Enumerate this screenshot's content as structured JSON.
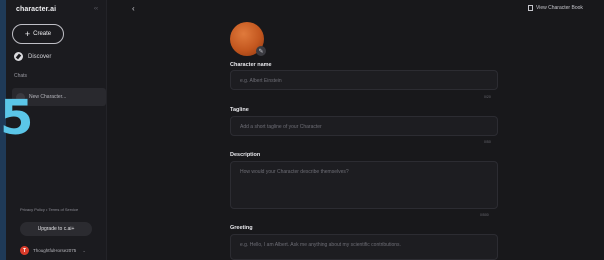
{
  "sidebar": {
    "brand": "character.ai",
    "create_label": "Create",
    "discover_label": "Discover",
    "chats_heading": "Chats",
    "chat_items": [
      {
        "label": "New Character..."
      }
    ],
    "footer_links": "Privacy Policy • Terms of Service",
    "upgrade_label": "Upgrade to c.ai+",
    "user": {
      "initial": "T",
      "name": "ThoughtfulHorse2075"
    }
  },
  "overlay_number": "5",
  "topbar": {
    "view_book_label": "View Character Book"
  },
  "form": {
    "name": {
      "label": "Character name",
      "placeholder": "e.g. Albert Einstein",
      "counter": "0/20"
    },
    "tagline": {
      "label": "Tagline",
      "placeholder": "Add a short tagline of your Character",
      "counter": "0/50"
    },
    "description": {
      "label": "Description",
      "placeholder": "How would your Character describe themselves?",
      "counter": "0/500"
    },
    "greeting": {
      "label": "Greeting",
      "placeholder": "e.g. Hello, I am Albert. Ask me anything about my scientific contributions."
    }
  },
  "colors": {
    "accent_overlay": "#5bc6e8",
    "avatar": "#c3571f",
    "background": "#18181b"
  }
}
